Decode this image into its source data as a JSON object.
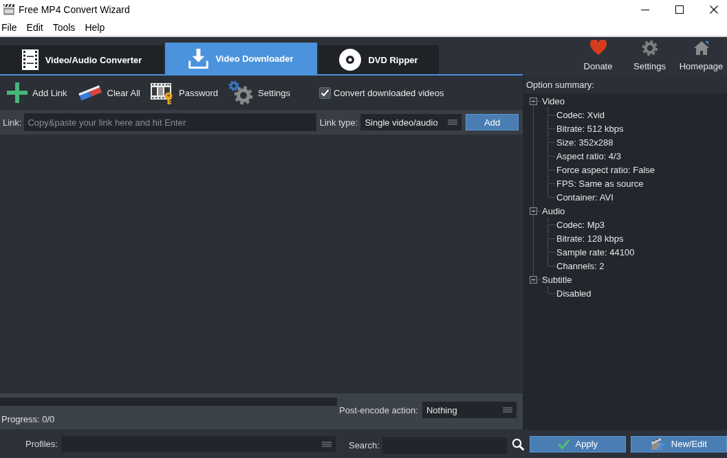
{
  "window": {
    "title": "Free MP4 Convert Wizard"
  },
  "menu": [
    "File",
    "Edit",
    "Tools",
    "Help"
  ],
  "tabs": [
    {
      "label": "Video/Audio Converter",
      "selected": false
    },
    {
      "label": "Video Downloader",
      "selected": true
    },
    {
      "label": "DVD Ripper",
      "selected": false
    }
  ],
  "top_actions": [
    "Donate",
    "Settings",
    "Homepage"
  ],
  "toolbar": {
    "buttons": [
      "Add Link",
      "Clear All",
      "Password",
      "Settings"
    ],
    "convert_option": {
      "label": "Convert downloaded videos",
      "checked": true
    }
  },
  "link_bar": {
    "label": "Link:",
    "placeholder": "Copy&paste your link here and hit Enter",
    "link_type_label": "Link type:",
    "link_type": "Single video/audio",
    "add_button": "Add"
  },
  "progress": {
    "level": 0,
    "text": "Progress: 0/0",
    "post_encode_label": "Post-encode action:",
    "post_encode_action": "Nothing"
  },
  "option_summary": {
    "title": "Option summary:",
    "tree": [
      {
        "label": "Video",
        "expanded": true,
        "children": [
          {
            "label": "Codec: Xvid"
          },
          {
            "label": "Bitrate: 512 kbps"
          },
          {
            "label": "Size: 352x288"
          },
          {
            "label": "Aspect ratio: 4/3"
          },
          {
            "label": "Force aspect ratio: False"
          },
          {
            "label": "FPS: Same as source"
          },
          {
            "label": "Container: AVI"
          }
        ]
      },
      {
        "label": "Audio",
        "expanded": true,
        "children": [
          {
            "label": "Codec: Mp3"
          },
          {
            "label": "Bitrate: 128 kbps"
          },
          {
            "label": "Sample rate: 44100"
          },
          {
            "label": "Channels: 2"
          }
        ]
      },
      {
        "label": "Subtitle",
        "expanded": true,
        "children": [
          {
            "label": "Disabled"
          }
        ]
      }
    ]
  },
  "bottom_bar": {
    "profiles_label": "Profiles:",
    "search_label": "Search:",
    "buttons": [
      "Apply",
      "New/Edit"
    ]
  }
}
